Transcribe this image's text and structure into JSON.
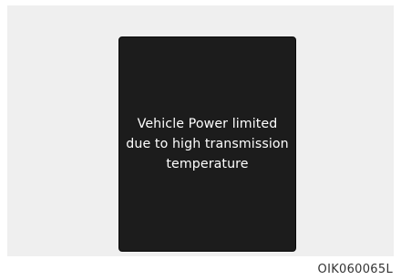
{
  "message": {
    "line1": "Vehicle Power limited",
    "line2": "due to high transmission",
    "line3": "temperature"
  },
  "figure_code": "OIK060065L",
  "colors": {
    "panel_background": "#efefef",
    "display_background": "#1c1c1c",
    "message_text": "#ffffff"
  }
}
